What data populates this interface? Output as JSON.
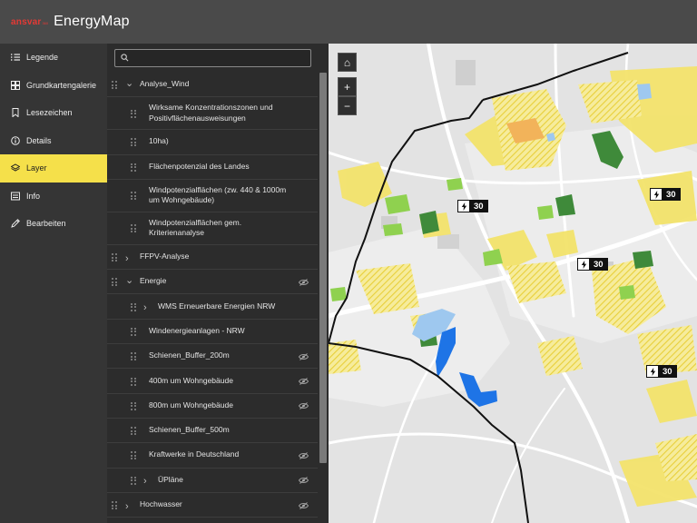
{
  "header": {
    "logo_text": "ansvar",
    "logo_sub": "360",
    "app_title": "EnergyMap"
  },
  "sidebar": {
    "items": [
      {
        "label": "Legende",
        "icon": "list-icon",
        "active": false
      },
      {
        "label": "Grundkartengalerie",
        "icon": "basemap-gallery-icon",
        "active": false
      },
      {
        "label": "Lesezeichen",
        "icon": "bookmark-icon",
        "active": false
      },
      {
        "label": "Details",
        "icon": "info-circle-icon",
        "active": false
      },
      {
        "label": "Layer",
        "icon": "layers-icon",
        "active": true
      },
      {
        "label": "Info",
        "icon": "info-card-icon",
        "active": false
      },
      {
        "label": "Bearbeiten",
        "icon": "edit-icon",
        "active": false
      }
    ]
  },
  "layer_panel": {
    "search": {
      "placeholder": "",
      "value": ""
    },
    "layers": [
      {
        "label": "Analyse_Wind",
        "level": 0,
        "chevron": "down",
        "hidden": false
      },
      {
        "label": "Wirksame Konzentrationszonen und Positivflächenausweisungen",
        "level": 1,
        "chevron": "",
        "hidden": false
      },
      {
        "label": "10ha)",
        "level": 1,
        "chevron": "",
        "hidden": false
      },
      {
        "label": "Flächenpotenzial des Landes",
        "level": 1,
        "chevron": "",
        "hidden": false
      },
      {
        "label": "Windpotenzialflächen (zw. 440 & 1000m um Wohngebäude)",
        "level": 1,
        "chevron": "",
        "hidden": false
      },
      {
        "label": "Windpotenzialflächen gem. Kriterienanalyse",
        "level": 1,
        "chevron": "",
        "hidden": false
      },
      {
        "label": "FFPV-Analyse",
        "level": 0,
        "chevron": "right",
        "hidden": false
      },
      {
        "label": "Energie",
        "level": 0,
        "chevron": "down",
        "hidden": true
      },
      {
        "label": "WMS Erneuerbare Energien NRW",
        "level": 1,
        "chevron": "right",
        "hidden": false
      },
      {
        "label": "Windenergieanlagen - NRW",
        "level": 1,
        "chevron": "",
        "hidden": false
      },
      {
        "label": "Schienen_Buffer_200m",
        "level": 1,
        "chevron": "",
        "hidden": true
      },
      {
        "label": "400m um Wohngebäude",
        "level": 1,
        "chevron": "",
        "hidden": true
      },
      {
        "label": "800m um Wohngebäude",
        "level": 1,
        "chevron": "",
        "hidden": true
      },
      {
        "label": "Schienen_Buffer_500m",
        "level": 1,
        "chevron": "",
        "hidden": false
      },
      {
        "label": "Kraftwerke in Deutschland",
        "level": 1,
        "chevron": "",
        "hidden": true
      },
      {
        "label": "ÜPläne",
        "level": 1,
        "chevron": "right",
        "hidden": true
      },
      {
        "label": "Hochwasser",
        "level": 0,
        "chevron": "right",
        "hidden": true
      }
    ]
  },
  "map": {
    "controls": [
      {
        "name": "home-button",
        "symbol": "⌂"
      },
      {
        "name": "zoom-in-button",
        "symbol": "+"
      },
      {
        "name": "zoom-out-button",
        "symbol": "−"
      }
    ],
    "speed_signs": [
      {
        "value": "30"
      },
      {
        "value": "30"
      },
      {
        "value": "30"
      },
      {
        "value": "30"
      }
    ],
    "colors": {
      "base": "#e3e3e3",
      "road": "#ffffff",
      "wind_zone": "#f3e36b",
      "forest": "#3f8a3a",
      "green": "#8fd14f",
      "water": "#1e74e6",
      "boundary": "#111111"
    }
  }
}
